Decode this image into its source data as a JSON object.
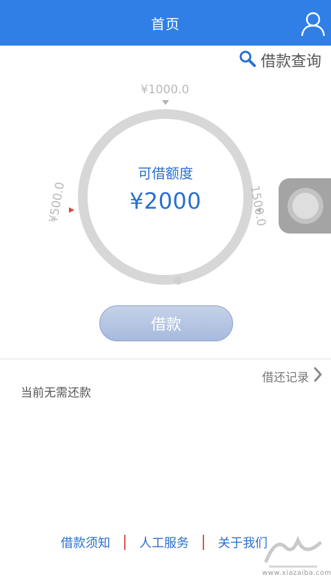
{
  "colors": {
    "brand": "#2f7fe6",
    "accent_blue": "#2a6fcf",
    "marker_red": "#e0443a",
    "ring_gray": "#d7d7d7"
  },
  "header": {
    "title": "首页",
    "user_icon": "user-icon"
  },
  "query": {
    "label": "借款查询",
    "icon": "search-icon"
  },
  "dial": {
    "ticks": {
      "top": "¥1000.0",
      "left": "¥500.0",
      "right": "1500.0"
    },
    "caption": "可借额度",
    "amount": "¥2000"
  },
  "borrow_button": {
    "label": "借款"
  },
  "records": {
    "label": "借还记录",
    "icon": "chevron-right-icon"
  },
  "status": {
    "text": "当前无需还款"
  },
  "footer": {
    "links": [
      "借款须知",
      "人工服务",
      "关于我们"
    ]
  },
  "watermark": {
    "site": "www.xiazaiba.com"
  }
}
